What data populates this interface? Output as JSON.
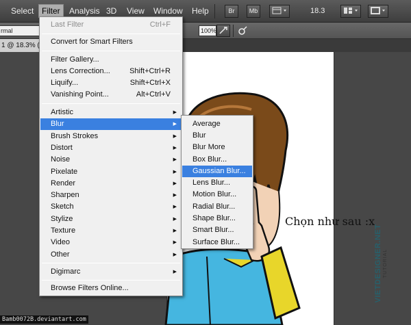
{
  "menubar": {
    "items": [
      "Select",
      "Filter",
      "Analysis",
      "3D",
      "View",
      "Window",
      "Help"
    ],
    "bridge_label": "Br",
    "minibridge_label": "Mb",
    "zoom": "18.3"
  },
  "options": {
    "mode_value": "rmal",
    "opacity_value": "100%"
  },
  "document": {
    "tab_label": "1 @ 18.3% (",
    "caption": "Chọn như sau :x",
    "credit": "Bamb0072B.deviantart.com",
    "watermark_main": "VIETDESIGNER.NET",
    "watermark_sub": "TUTORIAL"
  },
  "filter_menu": {
    "last_filter": {
      "label": "Last Filter",
      "shortcut": "Ctrl+F"
    },
    "smart": "Convert for Smart Filters",
    "gallery": "Filter Gallery...",
    "lens": {
      "label": "Lens Correction...",
      "shortcut": "Shift+Ctrl+R"
    },
    "liquify": {
      "label": "Liquify...",
      "shortcut": "Shift+Ctrl+X"
    },
    "vanishing": {
      "label": "Vanishing Point...",
      "shortcut": "Alt+Ctrl+V"
    },
    "submenus": [
      "Artistic",
      "Blur",
      "Brush Strokes",
      "Distort",
      "Noise",
      "Pixelate",
      "Render",
      "Sharpen",
      "Sketch",
      "Stylize",
      "Texture",
      "Video",
      "Other"
    ],
    "digimarc": "Digimarc",
    "browse": "Browse Filters Online..."
  },
  "blur_menu": {
    "items": [
      "Average",
      "Blur",
      "Blur More",
      "Box Blur...",
      "Gaussian Blur...",
      "Lens Blur...",
      "Motion Blur...",
      "Radial Blur...",
      "Shape Blur...",
      "Smart Blur...",
      "Surface Blur..."
    ],
    "selected": "Gaussian Blur..."
  },
  "colors": {
    "menu_highlight": "#3a80e0",
    "hair": "#7a4a1a",
    "shirt": "#45b6e0",
    "sleeve": "#e8d62a"
  }
}
